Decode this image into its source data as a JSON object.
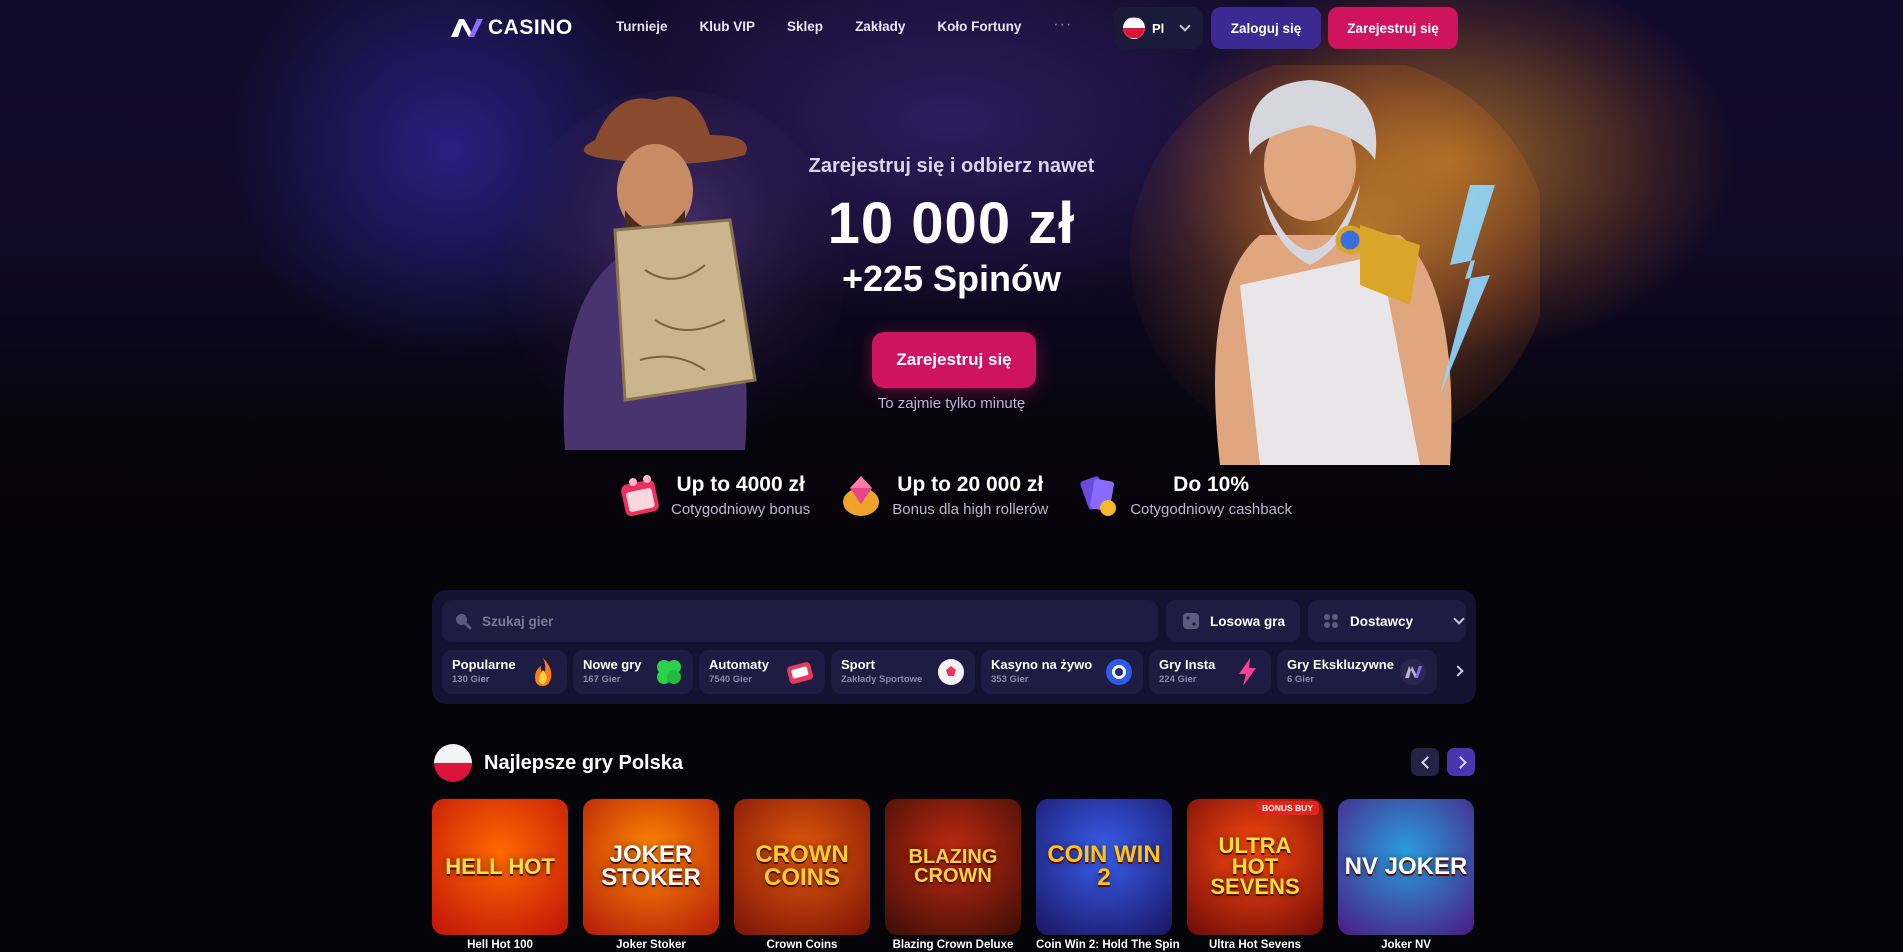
{
  "header": {
    "logo_text": "CASINO",
    "nav": [
      "Turnieje",
      "Klub VIP",
      "Sklep",
      "Zakłady",
      "Koło Fortuny"
    ],
    "more": "···",
    "lang": "Pl",
    "login": "Zaloguj się",
    "register": "Zarejestruj się"
  },
  "hero": {
    "subtitle": "Zarejestruj się i odbierz nawet",
    "amount": "10 000 zł",
    "spins": "+225 Spinów",
    "cta": "Zarejestruj się",
    "note": "To zajmie tylko minutę"
  },
  "bonuses": [
    {
      "title": "Up to 4000 zł",
      "sub": "Cotygodniowy bonus",
      "icon": "calendar-gift-icon"
    },
    {
      "title": "Up to 20 000 zł",
      "sub": "Bonus dla high rollerów",
      "icon": "diamond-bag-icon"
    },
    {
      "title": "Do 10%",
      "sub": "Cotygodniowy cashback",
      "icon": "cashback-cards-icon"
    }
  ],
  "search": {
    "placeholder": "Szukaj gier",
    "random": "Losowa gra",
    "providers": "Dostawcy"
  },
  "categories": [
    {
      "name": "Popularne",
      "count": "130 Gier",
      "icon": "fire-icon"
    },
    {
      "name": "Nowe gry",
      "count": "167 Gier",
      "icon": "clover-icon"
    },
    {
      "name": "Automaty",
      "count": "7540 Gier",
      "icon": "slot-machine-icon"
    },
    {
      "name": "Sport",
      "count": "Zakłady Sportowe",
      "icon": "football-icon"
    },
    {
      "name": "Kasyno na żywo",
      "count": "353 Gier",
      "icon": "poker-chip-icon"
    },
    {
      "name": "Gry Insta",
      "count": "224 Gier",
      "icon": "lightning-icon"
    },
    {
      "name": "Gry Ekskluzywne",
      "count": "6 Gier",
      "icon": "nv-logo-icon"
    }
  ],
  "section": {
    "title": "Najlepsze gry Polska"
  },
  "games": [
    {
      "name": "Hell Hot 100",
      "thumb_title": "HELL HOT",
      "bg1": "#ff6a00",
      "bg2": "#c0120a",
      "fg": "#ffe14d"
    },
    {
      "name": "Joker Stoker",
      "thumb_title": "JOKER STOKER",
      "bg1": "#ff8a00",
      "bg2": "#b3190c",
      "fg": "#ffffff"
    },
    {
      "name": "Crown Coins",
      "thumb_title": "CROWN COINS",
      "bg1": "#e35a0c",
      "bg2": "#7a1207",
      "fg": "#ffcc33"
    },
    {
      "name": "Blazing Crown Deluxe",
      "thumb_title": "BLAZING CROWN",
      "bg1": "#c42a12",
      "bg2": "#3a0d06",
      "fg": "#ffd24a"
    },
    {
      "name": "Coin Win 2: Hold The Spin",
      "thumb_title": "COIN WIN 2",
      "bg1": "#3a5ff0",
      "bg2": "#1a1460",
      "fg": "#ffc31a"
    },
    {
      "name": "Ultra Hot Sevens",
      "thumb_title": "ULTRA HOT SEVENS",
      "bg1": "#ff4a10",
      "bg2": "#6d0a08",
      "fg": "#ffdf3a",
      "badge": "BONUS BUY"
    },
    {
      "name": "Joker NV",
      "thumb_title": "NV JOKER",
      "bg1": "#2a9fe0",
      "bg2": "#4a1a80",
      "fg": "#ffffff"
    }
  ],
  "colors": {
    "accent_pink": "#d0135f",
    "accent_purple": "#3b2a91",
    "panel": "#141230"
  }
}
